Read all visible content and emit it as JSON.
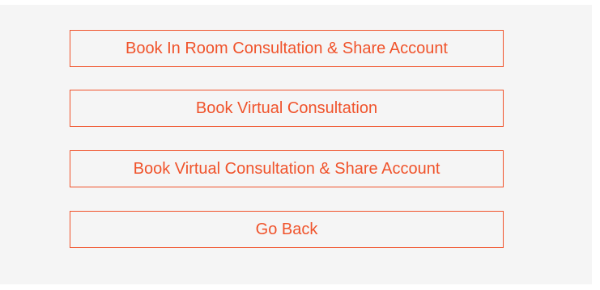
{
  "actions": {
    "book_in_room_share": "Book In Room Consultation & Share Account",
    "book_virtual": "Book Virtual Consultation",
    "book_virtual_share": "Book Virtual Consultation & Share Account",
    "go_back": "Go Back"
  },
  "colors": {
    "accent": "#f0532b",
    "panel_background": "#f5f5f5",
    "page_background": "#ffffff"
  }
}
